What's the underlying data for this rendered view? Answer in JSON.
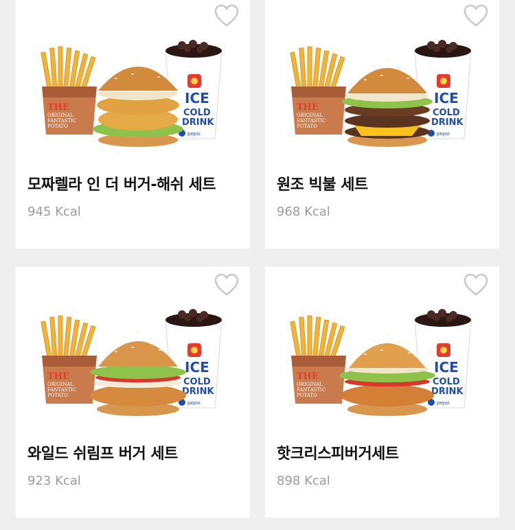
{
  "products": [
    {
      "name": "모짜렐라 인 더 버거-해쉬 세트",
      "kcal": "945 Kcal",
      "burger": "mozzarella-hash"
    },
    {
      "name": "원조 빅불 세트",
      "kcal": "968 Kcal",
      "burger": "bigbull"
    },
    {
      "name": "와일드 쉬림프 버거 세트",
      "kcal": "923 Kcal",
      "burger": "wild-shrimp"
    },
    {
      "name": "핫크리스피버거세트",
      "kcal": "898 Kcal",
      "burger": "hot-crispy"
    }
  ],
  "fries_box_text": [
    "THE",
    "ORIGINAL",
    "FANTASTIC",
    "POTATO"
  ],
  "cup_text": [
    "ICE",
    "COLD",
    "DRINK"
  ],
  "cup_brand": "pepsi",
  "icons": {
    "favorite": "heart-outline-icon"
  },
  "colors": {
    "heart": "#c8c8c8",
    "name": "#111111",
    "kcal": "#9a9a9a",
    "background": "#efefef"
  }
}
